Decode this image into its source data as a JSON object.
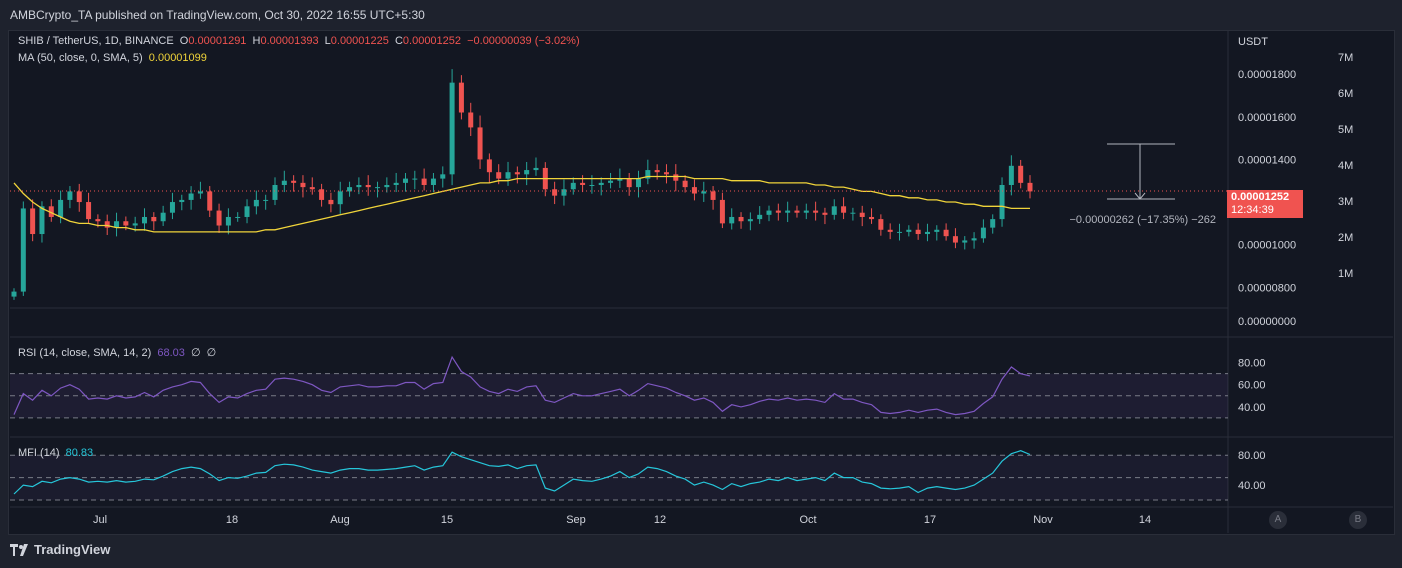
{
  "header": {
    "published": "AMBCrypto_TA published on TradingView.com, Oct 30, 2022 16:55 UTC+5:30"
  },
  "legend": {
    "symbol": "SHIB / TetherUS, 1D, BINANCE",
    "o_label": "O",
    "o": "0.00001291",
    "h_label": "H",
    "h": "0.00001393",
    "l_label": "L",
    "l": "0.00001225",
    "c_label": "C",
    "c": "0.00001252",
    "change": "−0.00000039 (−3.02%)",
    "ma_label": "MA (50, close, 0, SMA, 5)",
    "ma_value": "0.00001099",
    "rsi_label": "RSI (14, close, SMA, 14, 2)",
    "rsi_value": "68.03",
    "rsi_extra1": "∅",
    "rsi_extra2": "∅",
    "mfi_label": "MFI (14)",
    "mfi_value": "80.83"
  },
  "price_scale": {
    "currency": "USDT",
    "ticks": [
      "0.00001800",
      "0.00001600",
      "0.00001400",
      "0.00001000",
      "0.00000800",
      "0.00000000"
    ],
    "volume_ticks": [
      "7M",
      "6M",
      "5M",
      "4M",
      "3M",
      "2M",
      "1M"
    ],
    "last_price": "0.00001252",
    "countdown": "12:34:39",
    "measure_label": "−0.00000262 (−17.35%) −262"
  },
  "rsi_scale": {
    "ticks": [
      "80.00",
      "60.00",
      "40.00"
    ]
  },
  "mfi_scale": {
    "ticks": [
      "80.00",
      "40.00"
    ]
  },
  "time_axis": {
    "labels": [
      "Jul",
      "18",
      "Aug",
      "15",
      "Sep",
      "12",
      "Oct",
      "17",
      "Nov",
      "14"
    ]
  },
  "axis_buttons": {
    "a": "A",
    "b": "B"
  },
  "footer": {
    "brand": "TradingView"
  },
  "colors": {
    "up": "#26a69a",
    "down": "#ef5350",
    "ma": "#f0d43a",
    "rsi": "#7e57c2",
    "mfi": "#26c6da",
    "background": "#131722"
  },
  "chart_data": {
    "type": "candlestick",
    "symbol": "SHIB / TetherUS",
    "interval": "1D",
    "ohlc_last": {
      "open": 1.291e-05,
      "high": 1.393e-05,
      "low": 1.225e-05,
      "close": 1.252e-05
    },
    "close_series": [
      7.8e-06,
      1.17e-05,
      1.05e-05,
      1.18e-05,
      1.13e-05,
      1.21e-05,
      1.25e-05,
      1.2e-05,
      1.12e-05,
      1.11e-05,
      1.08e-05,
      1.11e-05,
      1.09e-05,
      1.1e-05,
      1.13e-05,
      1.11e-05,
      1.15e-05,
      1.2e-05,
      1.21e-05,
      1.24e-05,
      1.25e-05,
      1.16e-05,
      1.09e-05,
      1.13e-05,
      1.13e-05,
      1.18e-05,
      1.21e-05,
      1.21e-05,
      1.28e-05,
      1.3e-05,
      1.29e-05,
      1.27e-05,
      1.26e-05,
      1.21e-05,
      1.19e-05,
      1.25e-05,
      1.27e-05,
      1.28e-05,
      1.27e-05,
      1.27e-05,
      1.28e-05,
      1.29e-05,
      1.31e-05,
      1.31e-05,
      1.28e-05,
      1.31e-05,
      1.33e-05,
      1.76e-05,
      1.62e-05,
      1.55e-05,
      1.4e-05,
      1.34e-05,
      1.31e-05,
      1.34e-05,
      1.33e-05,
      1.35e-05,
      1.36e-05,
      1.26e-05,
      1.23e-05,
      1.26e-05,
      1.29e-05,
      1.28e-05,
      1.28e-05,
      1.29e-05,
      1.3e-05,
      1.31e-05,
      1.27e-05,
      1.31e-05,
      1.35e-05,
      1.34e-05,
      1.33e-05,
      1.3e-05,
      1.27e-05,
      1.24e-05,
      1.25e-05,
      1.21e-05,
      1.1e-05,
      1.13e-05,
      1.11e-05,
      1.12e-05,
      1.14e-05,
      1.16e-05,
      1.15e-05,
      1.16e-05,
      1.15e-05,
      1.16e-05,
      1.15e-05,
      1.14e-05,
      1.18e-05,
      1.15e-05,
      1.15e-05,
      1.13e-05,
      1.12e-05,
      1.07e-05,
      1.06e-05,
      1.06e-05,
      1.07e-05,
      1.05e-05,
      1.06e-05,
      1.07e-05,
      1.04e-05,
      1.01e-05,
      1.02e-05,
      1.03e-05,
      1.08e-05,
      1.12e-05,
      1.28e-05,
      1.37e-05,
      1.29e-05,
      1.25e-05
    ],
    "ma_series": [
      1.29e-05,
      1.24e-05,
      1.2e-05,
      1.17e-05,
      1.15e-05,
      1.13e-05,
      1.11e-05,
      1.1e-05,
      1.1e-05,
      1.09e-05,
      1.09e-05,
      1.08e-05,
      1.08e-05,
      1.07e-05,
      1.07e-05,
      1.06e-05,
      1.06e-05,
      1.06e-05,
      1.06e-05,
      1.06e-05,
      1.06e-05,
      1.06e-05,
      1.06e-05,
      1.06e-05,
      1.06e-05,
      1.06e-05,
      1.06e-05,
      1.07e-05,
      1.07e-05,
      1.08e-05,
      1.09e-05,
      1.1e-05,
      1.11e-05,
      1.12e-05,
      1.13e-05,
      1.14e-05,
      1.15e-05,
      1.16e-05,
      1.17e-05,
      1.18e-05,
      1.19e-05,
      1.2e-05,
      1.21e-05,
      1.22e-05,
      1.23e-05,
      1.24e-05,
      1.25e-05,
      1.26e-05,
      1.27e-05,
      1.28e-05,
      1.29e-05,
      1.29e-05,
      1.3e-05,
      1.3e-05,
      1.31e-05,
      1.31e-05,
      1.31e-05,
      1.31e-05,
      1.31e-05,
      1.31e-05,
      1.31e-05,
      1.31e-05,
      1.31e-05,
      1.31e-05,
      1.31e-05,
      1.31e-05,
      1.31e-05,
      1.31e-05,
      1.32e-05,
      1.32e-05,
      1.32e-05,
      1.32e-05,
      1.32e-05,
      1.31e-05,
      1.31e-05,
      1.31e-05,
      1.31e-05,
      1.3e-05,
      1.3e-05,
      1.3e-05,
      1.3e-05,
      1.29e-05,
      1.29e-05,
      1.29e-05,
      1.29e-05,
      1.29e-05,
      1.28e-05,
      1.28e-05,
      1.27e-05,
      1.27e-05,
      1.26e-05,
      1.25e-05,
      1.25e-05,
      1.24e-05,
      1.23e-05,
      1.23e-05,
      1.22e-05,
      1.22e-05,
      1.21e-05,
      1.21e-05,
      1.2e-05,
      1.2e-05,
      1.19e-05,
      1.19e-05,
      1.18e-05,
      1.18e-05,
      1.18e-05,
      1.17e-05,
      1.17e-05,
      1.17e-05
    ],
    "rsi_series": [
      33,
      52,
      46,
      55,
      50,
      57,
      60,
      56,
      47,
      48,
      47,
      50,
      48,
      49,
      53,
      49,
      55,
      58,
      60,
      63,
      62,
      52,
      44,
      49,
      48,
      52,
      55,
      56,
      65,
      66,
      65,
      63,
      60,
      55,
      53,
      58,
      59,
      60,
      58,
      58,
      59,
      59,
      62,
      62,
      56,
      61,
      62,
      85,
      72,
      67,
      58,
      54,
      52,
      56,
      54,
      58,
      59,
      46,
      44,
      48,
      52,
      50,
      50,
      52,
      54,
      56,
      50,
      55,
      61,
      59,
      57,
      53,
      50,
      46,
      48,
      44,
      36,
      42,
      40,
      42,
      45,
      47,
      46,
      48,
      46,
      47,
      46,
      44,
      52,
      47,
      47,
      44,
      42,
      35,
      34,
      35,
      37,
      35,
      37,
      38,
      35,
      33,
      34,
      36,
      43,
      49,
      65,
      76,
      70,
      68
    ],
    "mfi_series": [
      28,
      40,
      38,
      45,
      43,
      48,
      50,
      48,
      44,
      45,
      44,
      46,
      44,
      45,
      48,
      47,
      52,
      58,
      62,
      64,
      62,
      55,
      46,
      50,
      49,
      52,
      56,
      57,
      66,
      68,
      67,
      64,
      60,
      58,
      56,
      60,
      62,
      62,
      60,
      60,
      61,
      62,
      64,
      66,
      60,
      64,
      66,
      84,
      78,
      74,
      70,
      66,
      65,
      67,
      62,
      66,
      67,
      36,
      32,
      40,
      48,
      46,
      45,
      48,
      52,
      58,
      50,
      55,
      64,
      62,
      58,
      52,
      48,
      40,
      44,
      40,
      34,
      42,
      38,
      42,
      44,
      48,
      46,
      50,
      46,
      48,
      50,
      46,
      56,
      50,
      50,
      44,
      42,
      36,
      35,
      36,
      38,
      30,
      36,
      38,
      36,
      34,
      36,
      40,
      48,
      56,
      72,
      82,
      86,
      81
    ],
    "ylim": [
      7.5e-06,
      1.96e-05
    ],
    "rsi_ylim": [
      20,
      95
    ],
    "mfi_ylim": [
      20,
      95
    ]
  }
}
